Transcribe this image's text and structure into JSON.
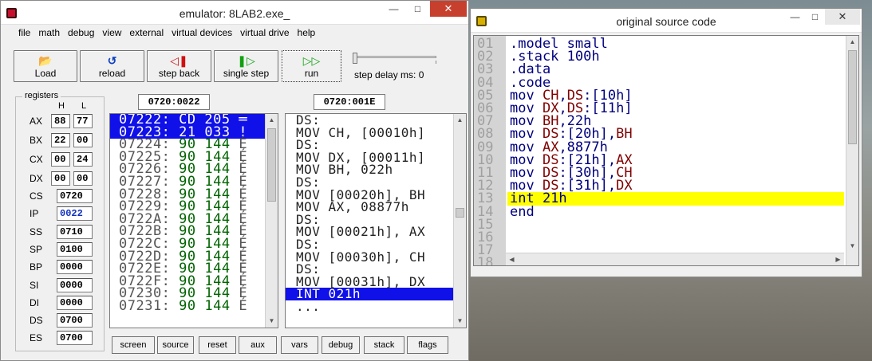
{
  "emulator": {
    "title": "emulator: 8LAB2.exe_",
    "menu": [
      "file",
      "math",
      "debug",
      "view",
      "external",
      "virtual devices",
      "virtual drive",
      "help"
    ],
    "toolbar": {
      "load": "Load",
      "reload": "reload",
      "step_back": "step back",
      "single_step": "single step",
      "run": "run",
      "step_delay": "step delay ms: 0"
    },
    "registers": {
      "label": "registers",
      "h_header": "H",
      "l_header": "L",
      "split": [
        {
          "name": "AX",
          "h": "88",
          "l": "77"
        },
        {
          "name": "BX",
          "h": "22",
          "l": "00"
        },
        {
          "name": "CX",
          "h": "00",
          "l": "24"
        },
        {
          "name": "DX",
          "h": "00",
          "l": "00"
        }
      ],
      "full": [
        {
          "name": "CS",
          "value": "0720"
        },
        {
          "name": "IP",
          "value": "0022"
        },
        {
          "name": "SS",
          "value": "0710"
        },
        {
          "name": "SP",
          "value": "0100"
        },
        {
          "name": "BP",
          "value": "0000"
        },
        {
          "name": "SI",
          "value": "0000"
        },
        {
          "name": "DI",
          "value": "0000"
        },
        {
          "name": "DS",
          "value": "0700"
        },
        {
          "name": "ES",
          "value": "0700"
        }
      ]
    },
    "memory_address": "0720:0022",
    "disasm_address": "0720:001E",
    "memory": [
      {
        "addr": "07222:",
        "bytes": "CD 205",
        "ch": "═"
      },
      {
        "addr": "07223:",
        "bytes": "21 033",
        "ch": "!"
      },
      {
        "addr": "07224:",
        "bytes": "90 144",
        "ch": "É"
      },
      {
        "addr": "07225:",
        "bytes": "90 144",
        "ch": "É"
      },
      {
        "addr": "07226:",
        "bytes": "90 144",
        "ch": "É"
      },
      {
        "addr": "07227:",
        "bytes": "90 144",
        "ch": "É"
      },
      {
        "addr": "07228:",
        "bytes": "90 144",
        "ch": "É"
      },
      {
        "addr": "07229:",
        "bytes": "90 144",
        "ch": "É"
      },
      {
        "addr": "0722A:",
        "bytes": "90 144",
        "ch": "É"
      },
      {
        "addr": "0722B:",
        "bytes": "90 144",
        "ch": "É"
      },
      {
        "addr": "0722C:",
        "bytes": "90 144",
        "ch": "É"
      },
      {
        "addr": "0722D:",
        "bytes": "90 144",
        "ch": "É"
      },
      {
        "addr": "0722E:",
        "bytes": "90 144",
        "ch": "É"
      },
      {
        "addr": "0722F:",
        "bytes": "90 144",
        "ch": "É"
      },
      {
        "addr": "07230:",
        "bytes": "90 144",
        "ch": "É"
      },
      {
        "addr": "07231:",
        "bytes": "90 144",
        "ch": "É"
      }
    ],
    "disassembly": [
      "DS:",
      "MOV CH, [00010h]",
      "DS:",
      "MOV DX, [00011h]",
      "MOV BH, 022h",
      "DS:",
      "MOV [00020h], BH",
      "MOV AX, 08877h",
      "DS:",
      "MOV [00021h], AX",
      "DS:",
      "MOV [00030h], CH",
      "DS:",
      "MOV [00031h], DX",
      "INT 021h",
      "..."
    ],
    "bottom_buttons": [
      "screen",
      "source",
      "reset",
      "aux",
      "vars",
      "debug",
      "stack",
      "flags"
    ]
  },
  "source": {
    "title": "original source code",
    "line_numbers": [
      "01",
      "02",
      "03",
      "04",
      "05",
      "06",
      "07",
      "08",
      "09",
      "10",
      "11",
      "12",
      "13",
      "14",
      "15",
      "16",
      "17",
      "18"
    ],
    "lines": [
      ".model small",
      ".stack 100h",
      ".data",
      ".code",
      "mov CH,DS:[10h]",
      "mov DX,DS:[11h]",
      "mov BH,22h",
      "mov DS:[20h],BH",
      "mov AX,8877h",
      "mov DS:[21h],AX",
      "mov DS:[30h],CH",
      "mov DS:[31h],DX",
      "int 21h",
      "end",
      "",
      "",
      "",
      ""
    ],
    "highlight_line": 13
  },
  "colors": {
    "selection": "#1010e8",
    "bytes": "#006400",
    "source_highlight": "#ffff00",
    "register_text": "#800000",
    "keyword_text": "#000080",
    "close_button": "#c7402e"
  }
}
